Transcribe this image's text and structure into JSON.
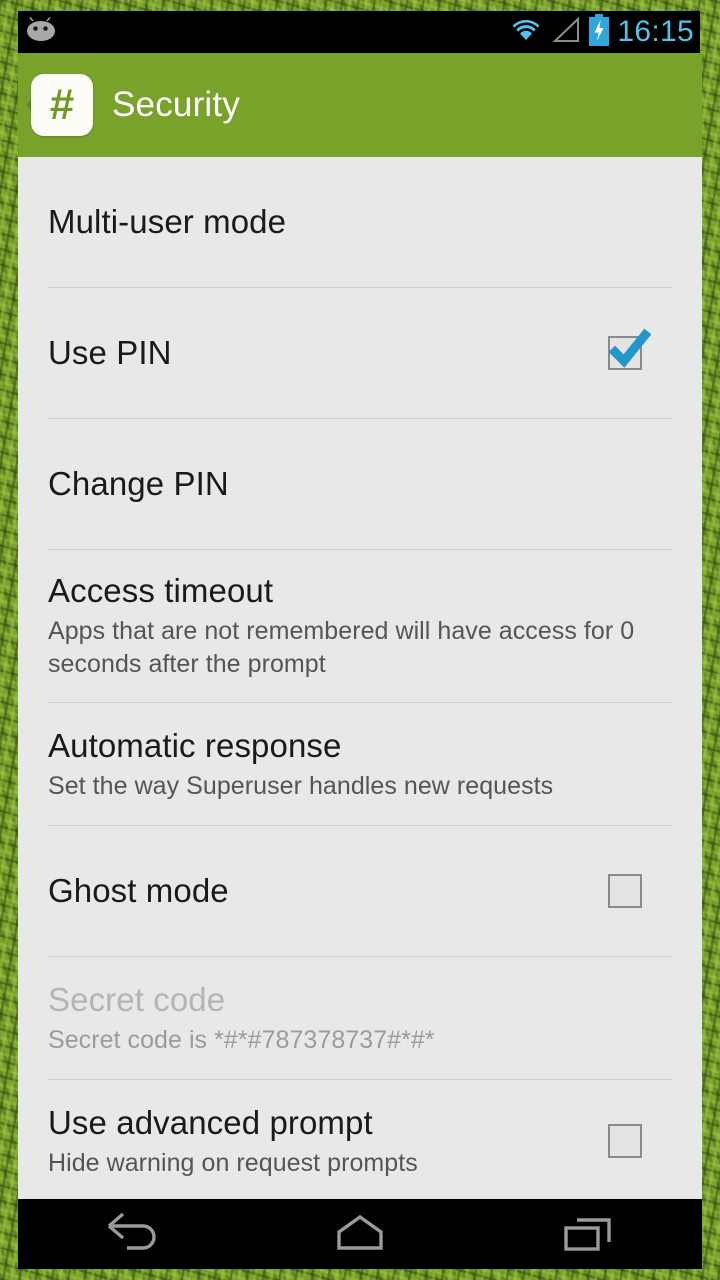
{
  "status_bar": {
    "notification_icon": "android-head-icon",
    "wifi_icon": "wifi-icon",
    "signal_icon": "signal-triangle-icon",
    "battery_icon": "battery-charging-icon",
    "time": "16:15",
    "time_color": "#4fc3e8"
  },
  "action_bar": {
    "up_icon": "back-chevron-icon",
    "app_icon": "hash-icon",
    "app_icon_glyph": "#",
    "title": "Security",
    "background_color": "#78a22a"
  },
  "settings": {
    "items": [
      {
        "title": "Multi-user mode",
        "subtitle": "",
        "widget": "none",
        "checked": false,
        "enabled": true
      },
      {
        "title": "Use PIN",
        "subtitle": "",
        "widget": "checkbox",
        "checked": true,
        "enabled": true
      },
      {
        "title": "Change PIN",
        "subtitle": "",
        "widget": "none",
        "checked": false,
        "enabled": true
      },
      {
        "title": "Access timeout",
        "subtitle": "Apps that are not remembered will have access for 0 seconds after the prompt",
        "widget": "none",
        "checked": false,
        "enabled": true
      },
      {
        "title": "Automatic response",
        "subtitle": "Set the way Superuser handles new requests",
        "widget": "none",
        "checked": false,
        "enabled": true
      },
      {
        "title": "Ghost mode",
        "subtitle": "",
        "widget": "checkbox",
        "checked": false,
        "enabled": true
      },
      {
        "title": "Secret code",
        "subtitle": "Secret code is *#*#787378737#*#*",
        "widget": "none",
        "checked": false,
        "enabled": false
      },
      {
        "title": "Use advanced prompt",
        "subtitle": "Hide warning on request prompts",
        "widget": "checkbox",
        "checked": false,
        "enabled": true
      }
    ]
  },
  "nav_bar": {
    "back_label": "back-icon",
    "home_label": "home-icon",
    "recents_label": "recents-icon"
  },
  "colors": {
    "accent_green": "#78a22a",
    "list_background": "#e8e8e8",
    "checkbox_check": "#2196c9",
    "disabled_text": "#b4b4b4"
  }
}
